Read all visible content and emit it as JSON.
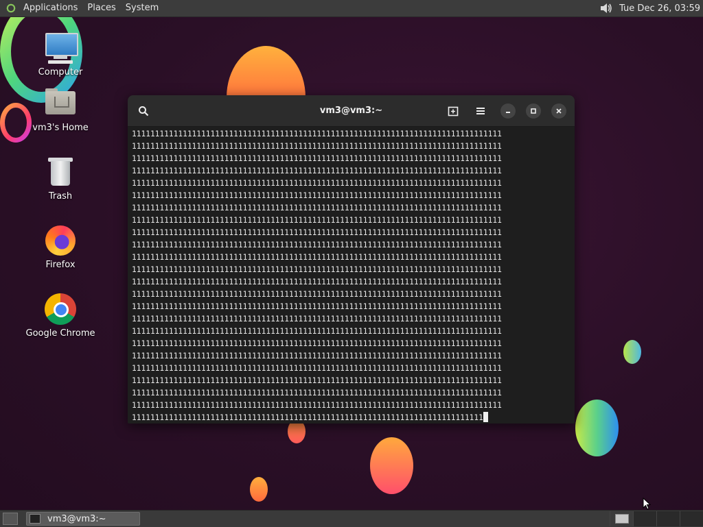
{
  "top_panel": {
    "menus": [
      "Applications",
      "Places",
      "System"
    ],
    "clock": "Tue Dec 26, 03:59"
  },
  "desktop_icons": [
    {
      "label": "Computer",
      "icon": "computer-icon"
    },
    {
      "label": "vm3's Home",
      "icon": "home-folder-icon"
    },
    {
      "label": "Trash",
      "icon": "trash-icon"
    },
    {
      "label": "Firefox",
      "icon": "firefox-icon"
    },
    {
      "label": "Google Chrome",
      "icon": "chrome-icon"
    }
  ],
  "terminal": {
    "title": "vm3@vm3:~",
    "full_line": "11111111111111111111111111111111111111111111111111111111111111111111111111111111",
    "last_line": "1111111111111111111111111111111111111111111111111111111111111111111111111111",
    "full_line_count": 23
  },
  "taskbar": {
    "window_label": "vm3@vm3:~"
  }
}
